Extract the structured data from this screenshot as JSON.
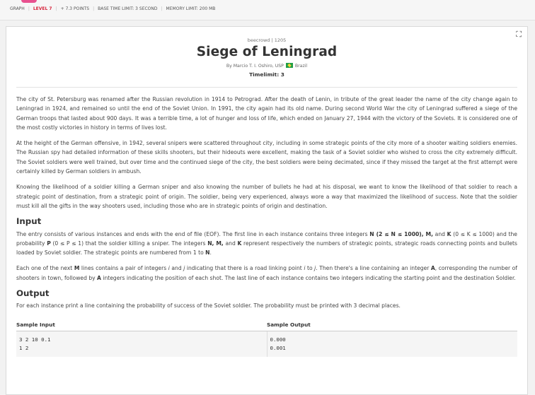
{
  "meta": {
    "category": "GRAPH",
    "level": "LEVEL 7",
    "points": "+ 7.3 POINTS",
    "time_limit": "BASE TIME LIMIT: 3 SECOND",
    "memory_limit": "MEMORY LIMIT: 200 MB"
  },
  "problem": {
    "judge": "beecrowd | 1205",
    "title": "Siege of Leningrad",
    "author_prefix": "By Marcio T. I. Oshiro, USP",
    "country": "Brazil",
    "timelimit": "Timelimit: 3"
  },
  "description": {
    "p1": "The city of St. Petersburg was renamed after the Russian revolution in 1914 to Petrograd. After the death of Lenin, in tribute of the great leader the name of the city change again to Leningrad in 1924, and remained so until the end of the Soviet Union. In 1991, the city again had its old name. During second World War the city of Leningrad suffered a siege of the German troops that lasted about 900 days. It was a terrible time, a lot of hunger and loss of life, which ended on January 27, 1944 with the victory of the Soviets. It is considered one of the most costly victories in history in terms of lives lost.",
    "p2": "At the height of the German offensive, in 1942, several snipers were scattered throughout city, including in some strategic points of the city more of a shooter waiting soldiers enemies. The Russian spy had detailed information of these skills shooters, but their hideouts were excellent, making the task of a Soviet soldier who wished to cross the city extremely difficult. The Soviet soldiers were well trained, but over time and the continued siege of the city, the best soldiers were being decimated, since if they missed the target at the first attempt were certainly killed by German soldiers in ambush.",
    "p3": "Knowing the likelihood of a soldier killing a German sniper and also knowing the number of bullets he had at his disposal, we want to know the likelihood of that soldier to reach a strategic point of destination, from a strategic point of origin. The soldier, being very experienced, always wore a way that maximized the likelihood of success. Note that the soldier must kill all the gifts in the way shooters used, including those who are in strategic points of origin and destination."
  },
  "input": {
    "heading": "Input",
    "p1_a": "The entry consists of various instances and ends with the end of file (EOF). The first line in each instance contains three integers ",
    "p1_b": "N (2 ≤ N ≤ 1000), M,",
    "p1_c": " and ",
    "p1_d": "K",
    "p1_e": " (0 ≤ K ≤ 1000) and the probability ",
    "p1_f": "P",
    "p1_g": " (0 ≤ P ≤ 1) that the soldier killing a sniper. The integers ",
    "p1_h": "N, M,",
    "p1_i": " and ",
    "p1_j": "K",
    "p1_k": " represent respectively the numbers of strategic points, strategic roads connecting points and bullets loaded by Soviet soldier. The strategic points are numbered from 1 to ",
    "p1_l": "N",
    "p1_m": ".",
    "p2_a": "Each one of the next ",
    "p2_b": "M",
    "p2_c": " lines contains a pair of integers ",
    "p2_d": "i",
    "p2_e": " and ",
    "p2_f": "j",
    "p2_g": " indicating that there is a road linking point ",
    "p2_h": "i",
    "p2_i": " to ",
    "p2_j": "j",
    "p2_k": ". Then there's a line containing an integer ",
    "p2_l": "A",
    "p2_m": ", corresponding the number of shooters in town, followed by ",
    "p2_n": "A",
    "p2_o": " integers indicating the position of each shot. The last line of each instance contains two integers indicating the starting point and the destination Soldier."
  },
  "output": {
    "heading": "Output",
    "p1": "For each instance print a line containing the probability of success of the Soviet soldier. The probability must be printed with 3 decimal places."
  },
  "samples": {
    "input_header": "Sample Input",
    "output_header": "Sample Output",
    "input_text": "3 2 10 0.1\n1 2",
    "output_text": "0.000\n0.001"
  }
}
